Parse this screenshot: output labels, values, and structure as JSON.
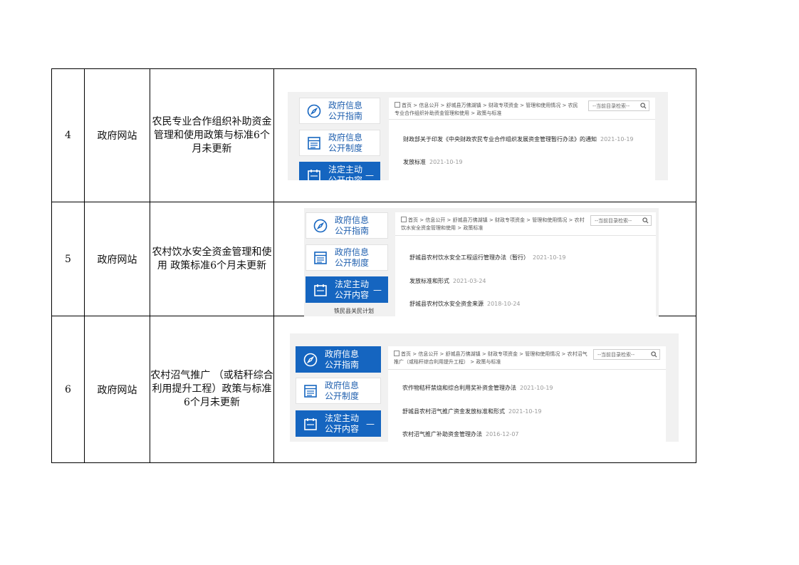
{
  "nav": {
    "btn1_label": "政府信息\n公开指南",
    "btn2_label": "政府信息\n公开制度",
    "btn3_label": "法定主动\n公开内容",
    "btn3_toggle": "—",
    "subnav_cut": "铁民县关民计划"
  },
  "search_placeholder": "--当前目录检索--",
  "rows": [
    {
      "num": "4",
      "type": "政府网站",
      "desc": "农民专业合作组织补助资金管理和使用政策与标准6个月未更新",
      "crumb": "首页 > 信息公开 > 舒城县万佛湖镇 > 财政专项资金 > 管理和使用情况 > 农民专业合作组织补助资金管理和使用 > 政策与标准",
      "items": [
        {
          "title": "财政部关于印发《中央财政农民专业合作组织发展资金管理暂行办法》的通知",
          "date": "2021-10-19"
        },
        {
          "title": "发放标准",
          "date": "2021-10-19"
        }
      ]
    },
    {
      "num": "5",
      "type": "政府网站",
      "desc": "农村饮水安全资金管理和使用 政策标准6个月未更新",
      "crumb": "首页 > 信息公开 > 舒城县万佛湖镇 > 财政专项资金 > 管理和使用情况 > 农村饮水安全资金管理和使用 > 政策标准",
      "items": [
        {
          "title": "舒城县农村饮水安全工程运行管理办法（暂行）",
          "date": "2021-10-19"
        },
        {
          "title": "发放标准和形式",
          "date": "2021-03-24"
        },
        {
          "title": "舒城县农村饮水安全资金来源",
          "date": "2018-10-24"
        }
      ]
    },
    {
      "num": "6",
      "type": "政府网站",
      "desc": "农村沼气推广 （或秸秆综合利用提升工程）政策与标准6个月未更新",
      "crumb": "首页 > 信息公开 > 舒城县万佛湖镇 > 财政专项资金 > 管理和使用情况 > 农村沼气推广（或秸秆综合利用提升工程） > 政策与标准",
      "items": [
        {
          "title": "农作物秸秆禁烧和综合利用奖补资金管理办法",
          "date": "2021-10-19"
        },
        {
          "title": "舒城县农村沼气推广资金发放标准和形式",
          "date": "2021-10-19"
        },
        {
          "title": "农村沼气推广补助资金管理办法",
          "date": "2016-12-07"
        }
      ]
    }
  ]
}
